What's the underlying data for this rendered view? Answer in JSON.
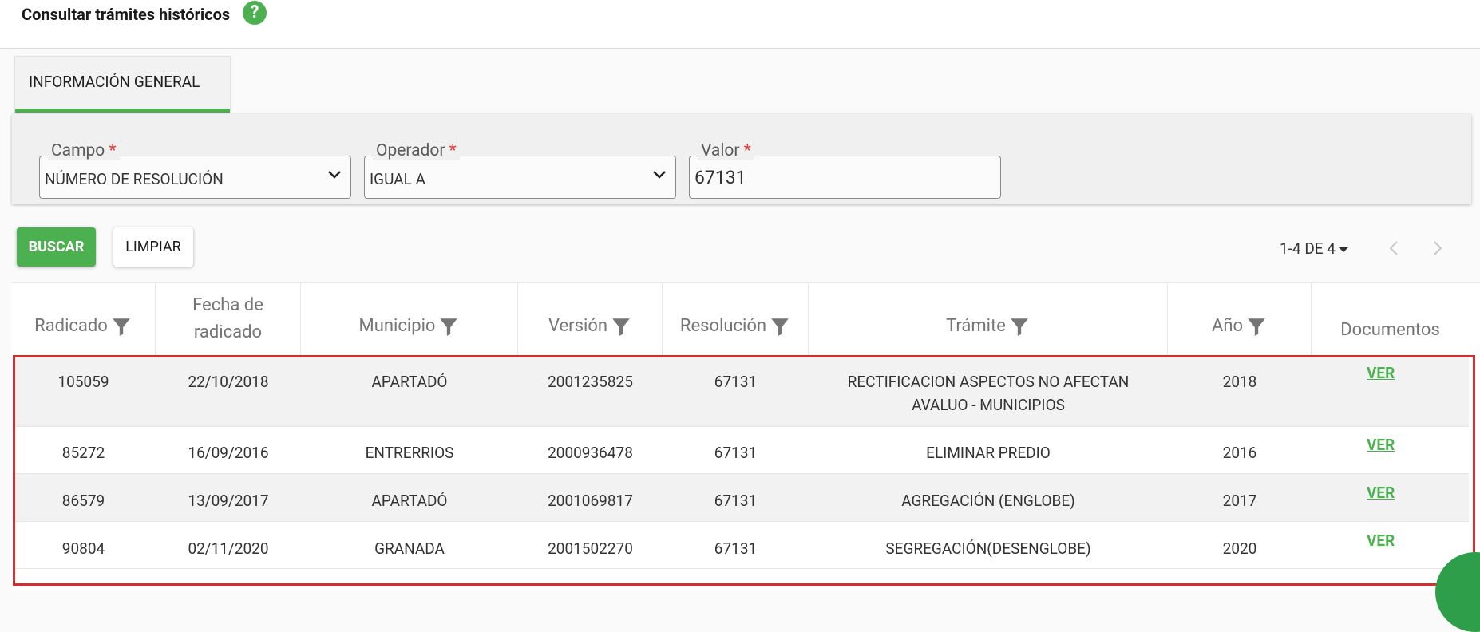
{
  "header": {
    "title": "Consultar trámites históricos",
    "help_glyph": "?"
  },
  "tabs": [
    {
      "label": "INFORMACIÓN GENERAL",
      "active": true
    }
  ],
  "filters": {
    "required_mark": "*",
    "campo": {
      "label": "Campo",
      "value": "NÚMERO DE RESOLUCIÓN"
    },
    "operador": {
      "label": "Operador",
      "value": "IGUAL A"
    },
    "valor": {
      "label": "Valor",
      "value": "67131"
    }
  },
  "actions": {
    "search_label": "BUSCAR",
    "clear_label": "LIMPIAR"
  },
  "pagination": {
    "label": "1-4 DE 4"
  },
  "table": {
    "columns": [
      {
        "label": "Radicado",
        "filter": true
      },
      {
        "label": "Fecha de radicado",
        "line1": "Fecha de",
        "line2": "radicado",
        "filter": false
      },
      {
        "label": "Municipio",
        "filter": true
      },
      {
        "label": "Versión",
        "filter": true
      },
      {
        "label": "Resolución",
        "filter": true
      },
      {
        "label": "Trámite",
        "filter": true
      },
      {
        "label": "Año",
        "filter": true
      },
      {
        "label": "Documentos",
        "filter": false
      }
    ],
    "rows": [
      {
        "radicado": "105059",
        "fecha": "22/10/2018",
        "municipio": "APARTADÓ",
        "version": "2001235825",
        "resolucion": "67131",
        "tramite_line1": "RECTIFICACION ASPECTOS NO AFECTAN",
        "tramite_line2": "AVALUO - MUNICIPIOS",
        "anio": "2018",
        "documentos": "VER"
      },
      {
        "radicado": "85272",
        "fecha": "16/09/2016",
        "municipio": "ENTRERRIOS",
        "version": "2000936478",
        "resolucion": "67131",
        "tramite_line1": "ELIMINAR PREDIO",
        "tramite_line2": "",
        "anio": "2016",
        "documentos": "VER"
      },
      {
        "radicado": "86579",
        "fecha": "13/09/2017",
        "municipio": "APARTADÓ",
        "version": "2001069817",
        "resolucion": "67131",
        "tramite_line1": "AGREGACIÓN (ENGLOBE)",
        "tramite_line2": "",
        "anio": "2017",
        "documentos": "VER"
      },
      {
        "radicado": "90804",
        "fecha": "02/11/2020",
        "municipio": "GRANADA",
        "version": "2001502270",
        "resolucion": "67131",
        "tramite_line1": "SEGREGACIÓN(DESENGLOBE)",
        "tramite_line2": "",
        "anio": "2020",
        "documentos": "VER"
      }
    ]
  },
  "icons": {
    "help": "question-circle-icon",
    "dropdown": "chevron-down-icon",
    "filter": "funnel-filter-icon",
    "prev": "chevron-left-icon",
    "next": "chevron-right-icon"
  },
  "colors": {
    "accent": "#4caf50",
    "required": "#e53935",
    "highlight": "#d32f2f"
  }
}
